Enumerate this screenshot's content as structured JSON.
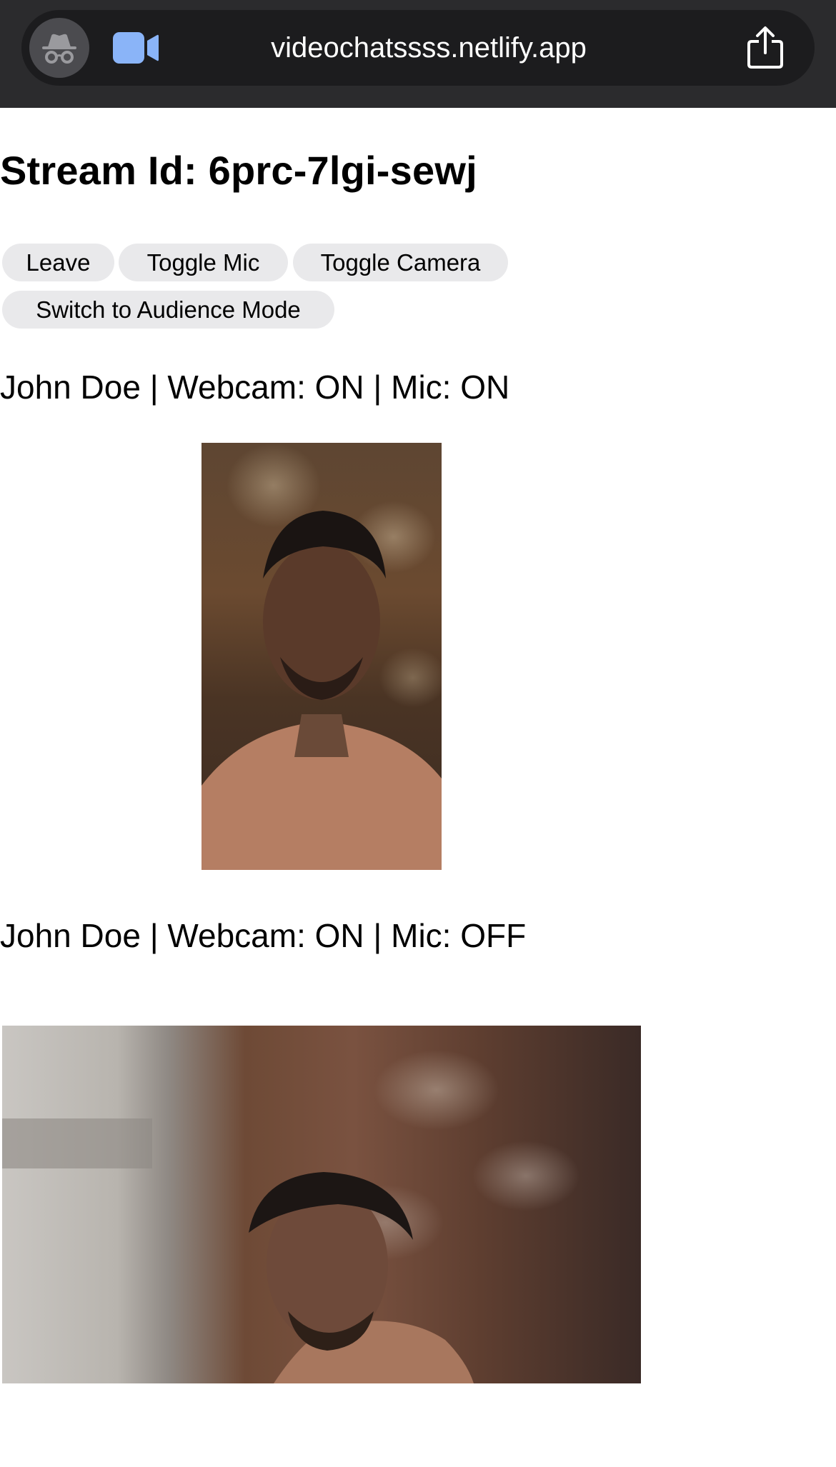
{
  "browser": {
    "url": "videochatssss.netlify.app"
  },
  "page": {
    "title": "Stream Id: 6prc-7lgi-sewj"
  },
  "controls": {
    "leave_label": "Leave",
    "toggle_mic_label": "Toggle Mic",
    "toggle_camera_label": "Toggle Camera",
    "audience_mode_label": "Switch to Audience Mode"
  },
  "participants": [
    {
      "status": "John Doe | Webcam: ON | Mic: ON"
    },
    {
      "status": "John Doe | Webcam: ON | Mic: OFF"
    }
  ],
  "colors": {
    "toolbar_bg": "#2b2b2d",
    "urlbar_bg": "#1c1c1e",
    "button_bg": "#e9e9eb",
    "accent_blue": "#8ab4f8"
  },
  "icons": [
    "incognito-icon",
    "video-camera-icon",
    "share-icon"
  ]
}
